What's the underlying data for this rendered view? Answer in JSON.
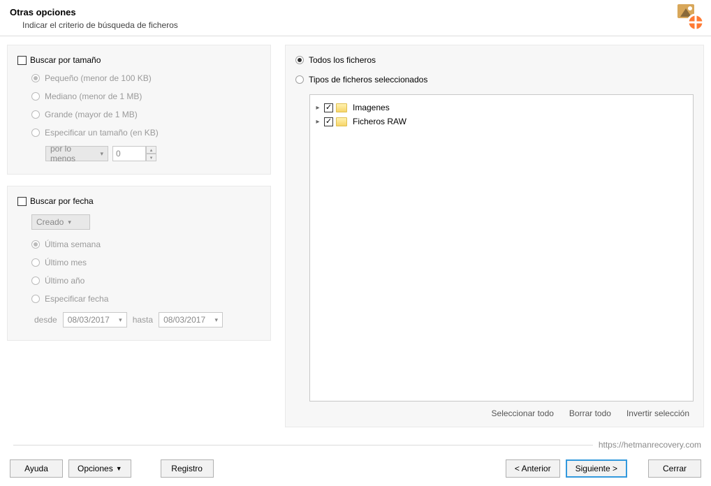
{
  "header": {
    "title": "Otras opciones",
    "subtitle": "Indicar el criterio de búsqueda de ficheros"
  },
  "size": {
    "group_label": "Buscar por tamaño",
    "small": "Pequeño (menor de 100 KB)",
    "medium": "Mediano (menor de 1 MB)",
    "large": "Grande (mayor de 1 MB)",
    "specify": "Especificar un tamaño (en KB)",
    "mode": "por lo menos",
    "value": "0"
  },
  "date": {
    "group_label": "Buscar por fecha",
    "type": "Creado",
    "last_week": "Última semana",
    "last_month": "Último mes",
    "last_year": "Último año",
    "specify": "Especificar fecha",
    "from_lbl": "desde",
    "from_val": "08/03/2017",
    "to_lbl": "hasta",
    "to_val": "08/03/2017"
  },
  "types": {
    "all": "Todos los ficheros",
    "selected": "Tipos de ficheros seleccionados",
    "tree": [
      {
        "label": "Imagenes"
      },
      {
        "label": "Ficheros RAW"
      }
    ],
    "select_all": "Seleccionar todo",
    "clear_all": "Borrar todo",
    "invert": "Invertir selección"
  },
  "footer": {
    "help": "Ayuda",
    "options": "Opciones",
    "log": "Registro",
    "back": "< Anterior",
    "next": "Siguiente >",
    "close": "Cerrar",
    "url": "https://hetmanrecovery.com"
  }
}
